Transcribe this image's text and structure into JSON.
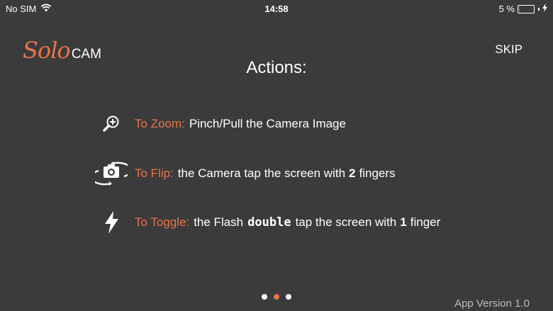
{
  "status_bar": {
    "carrier": "No SIM",
    "time": "14:58",
    "battery_text": "5 %",
    "battery_level": 0.05,
    "wifi_icon": "wifi-icon",
    "charging_icon": "bolt-icon"
  },
  "logo": {
    "solo": "Solo",
    "cam": "CAM"
  },
  "skip_label": "SKIP",
  "title": "Actions:",
  "actions": [
    {
      "icon": "zoom-in-icon",
      "label": "To Zoom:",
      "parts": [
        "Pinch/Pull the Camera Image"
      ]
    },
    {
      "icon": "camera-flip-icon",
      "label": "To Flip:",
      "parts": [
        "the Camera tap the screen with",
        "2",
        "fingers"
      ]
    },
    {
      "icon": "flash-icon",
      "label": "To Toggle:",
      "parts": [
        "the Flash",
        "double",
        "tap the screen with",
        "1",
        "finger"
      ]
    }
  ],
  "pagination": {
    "total": 3,
    "current": 2
  },
  "version": "App Version 1.0",
  "colors": {
    "background": "#3b3b3b",
    "accent": "#e8734a"
  }
}
